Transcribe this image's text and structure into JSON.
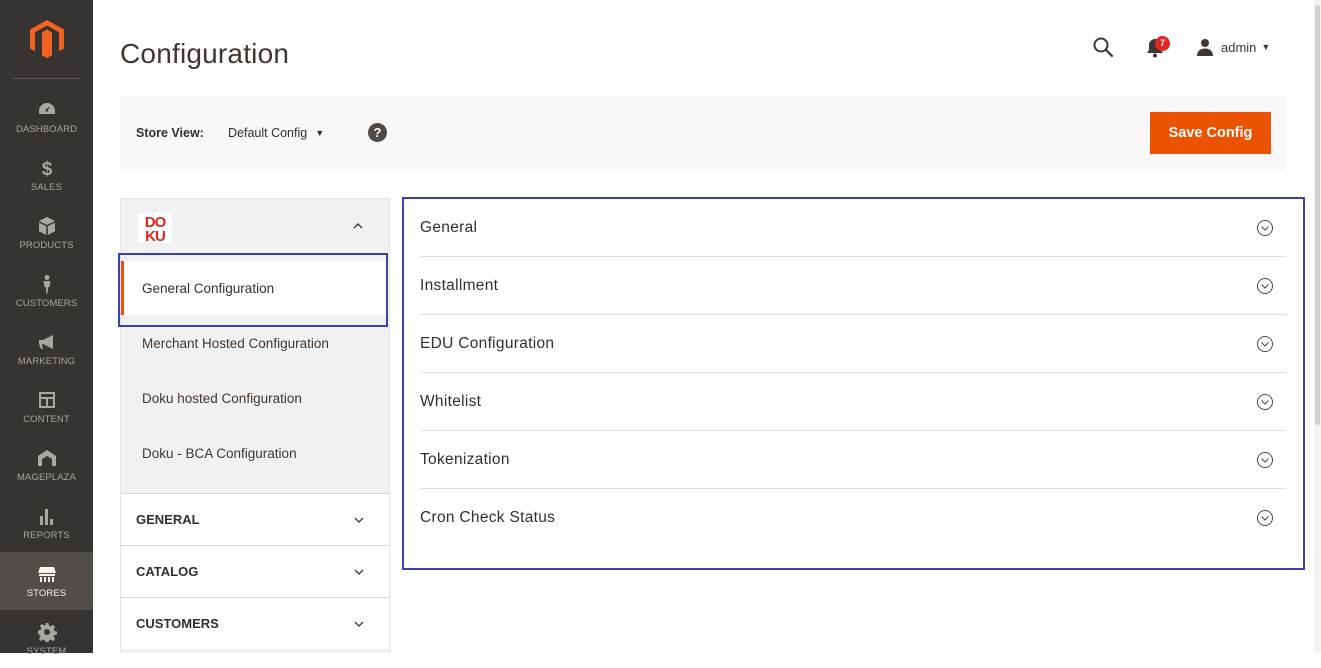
{
  "nav": {
    "items": [
      {
        "label": "DASHBOARD",
        "icon": "dashboard-icon"
      },
      {
        "label": "SALES",
        "icon": "dollar-icon"
      },
      {
        "label": "PRODUCTS",
        "icon": "box-icon"
      },
      {
        "label": "CUSTOMERS",
        "icon": "person-icon"
      },
      {
        "label": "MARKETING",
        "icon": "megaphone-icon"
      },
      {
        "label": "CONTENT",
        "icon": "layout-icon"
      },
      {
        "label": "MAGEPLAZA",
        "icon": "mageplaza-icon"
      },
      {
        "label": "REPORTS",
        "icon": "bar-chart-icon"
      },
      {
        "label": "STORES",
        "icon": "store-icon"
      },
      {
        "label": "SYSTEM",
        "icon": "gear-icon"
      }
    ],
    "active": "STORES"
  },
  "header": {
    "title": "Configuration",
    "notification_count": "7",
    "user": "admin"
  },
  "storebar": {
    "label": "Store View:",
    "value": "Default Config",
    "help": "?",
    "save_label": "Save Config"
  },
  "sidebar": {
    "doku_logo_text": "DOKU",
    "subitems": [
      {
        "label": "General Configuration",
        "active": true
      },
      {
        "label": "Merchant Hosted Configuration"
      },
      {
        "label": "Doku hosted Configuration"
      },
      {
        "label": "Doku - BCA Configuration"
      }
    ],
    "sections": [
      {
        "label": "GENERAL"
      },
      {
        "label": "CATALOG"
      },
      {
        "label": "CUSTOMERS"
      }
    ]
  },
  "main": {
    "sections": [
      {
        "title": "General"
      },
      {
        "title": "Installment"
      },
      {
        "title": "EDU Configuration"
      },
      {
        "title": "Whitelist"
      },
      {
        "title": "Tokenization"
      },
      {
        "title": "Cron Check Status"
      }
    ]
  },
  "colors": {
    "accent": "#eb5202",
    "nav_bg": "#373330",
    "highlight": "#3b3fb6"
  }
}
